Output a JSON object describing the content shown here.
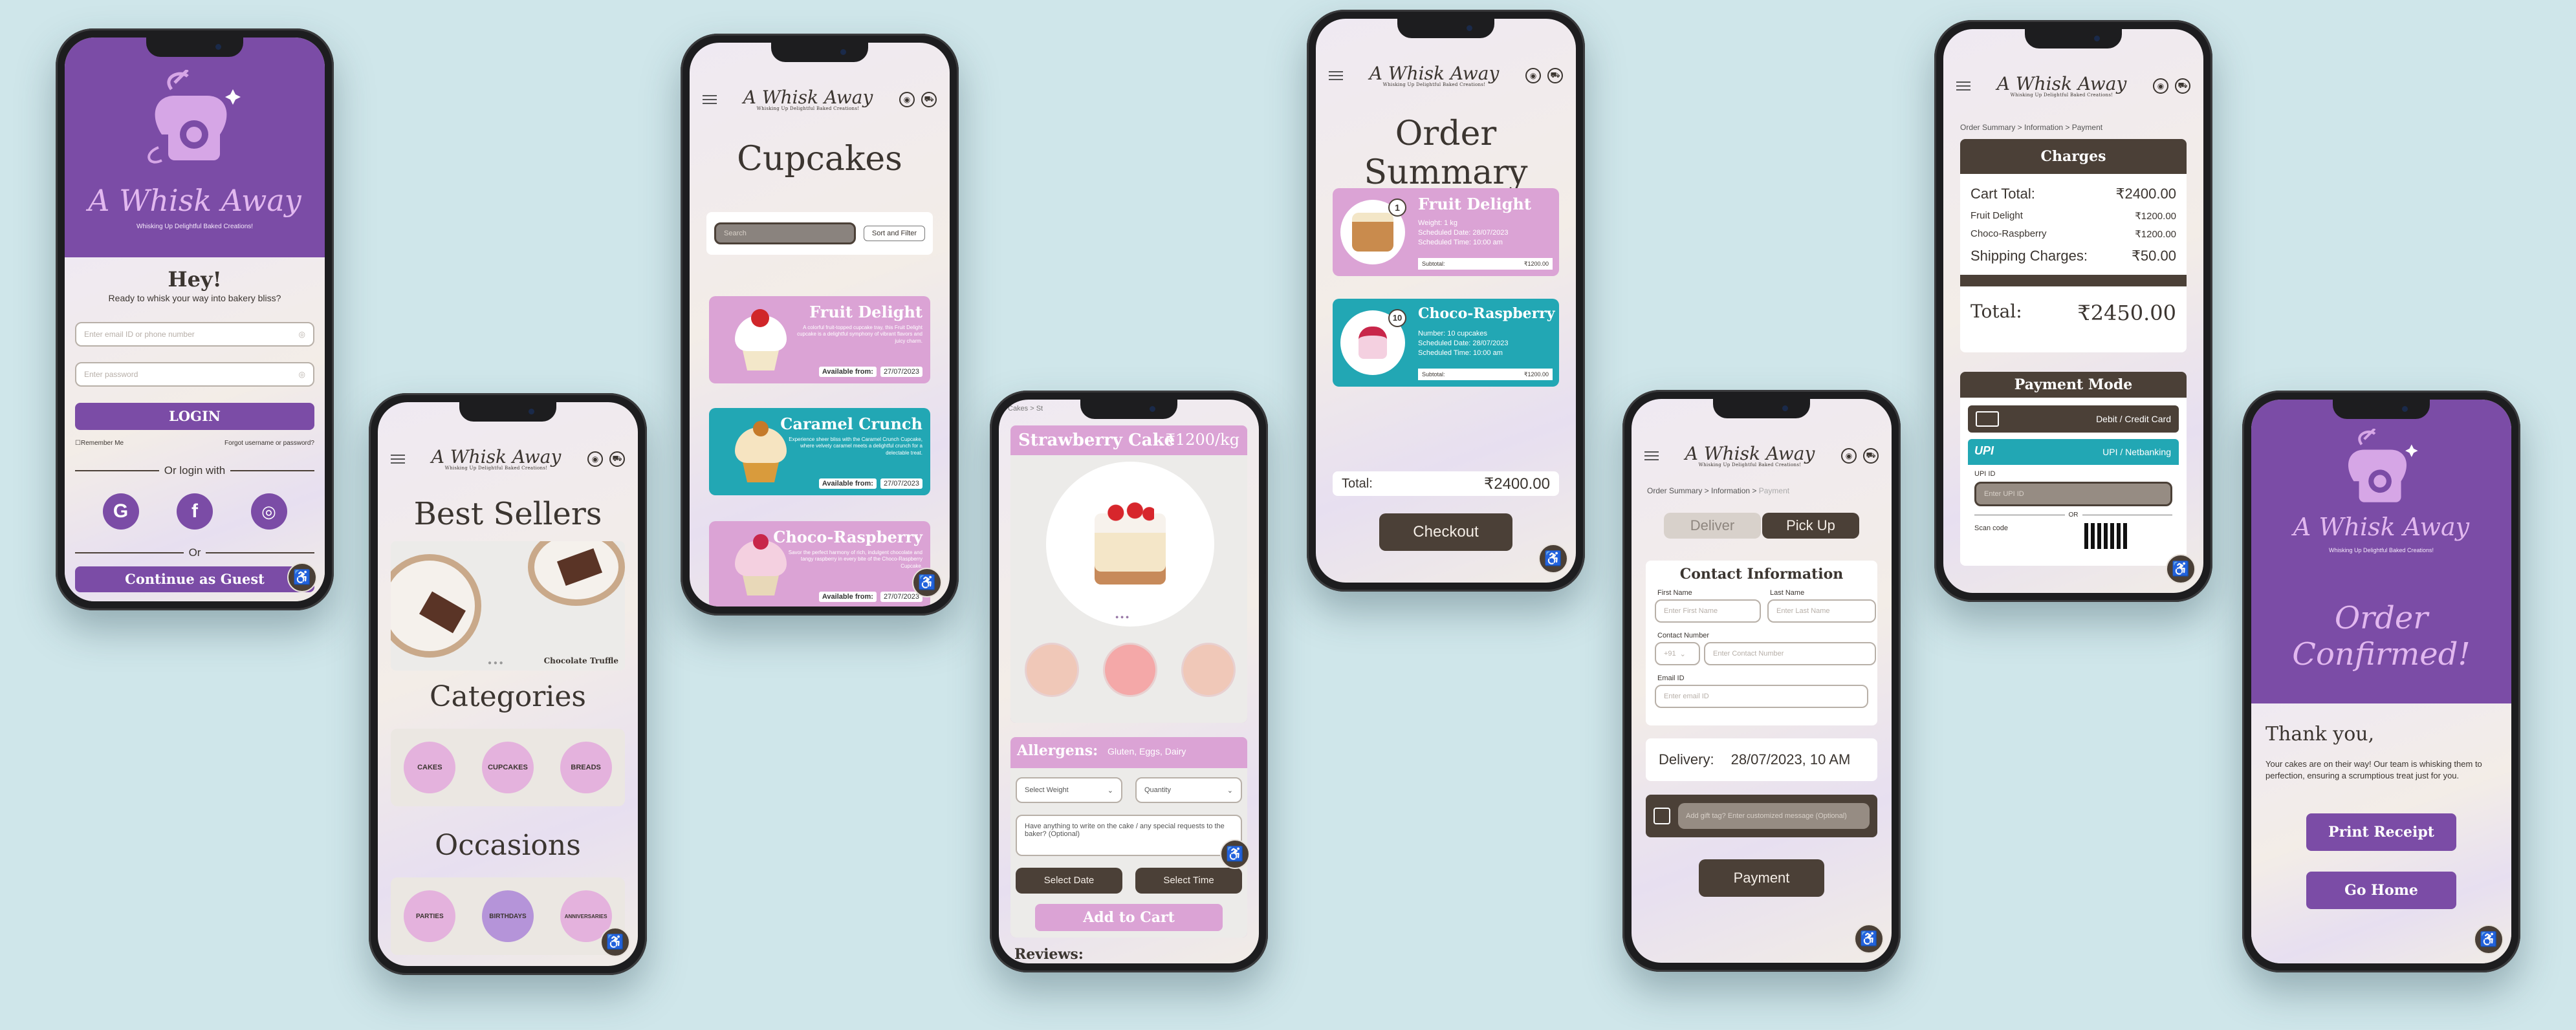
{
  "brand": {
    "name": "A Whisk Away",
    "tagline": "Whisking Up Delightful Baked Creations!"
  },
  "icons": {
    "accessibility": "accessibility-icon",
    "menu": "hamburger-menu-icon",
    "profile": "profile-icon",
    "cart": "cart-icon"
  },
  "colors": {
    "purple": "#7b4ca6",
    "dark": "#4b4037",
    "pink": "#dba3d5",
    "teal": "#22a7b4",
    "bg": "#cfe6ea"
  },
  "login": {
    "greeting": "Hey!",
    "subtitle": "Ready to whisk your way into bakery bliss?",
    "email_placeholder": "Enter email ID or phone number",
    "password_placeholder": "Enter password",
    "login_button": "LOGIN",
    "remember_me": "Remember Me",
    "forgot": "Forgot username or password?",
    "or_login_with": "Or login with",
    "or": "Or",
    "guest_button": "Continue as Guest"
  },
  "home": {
    "best_sellers": "Best Sellers",
    "featured_caption": "Chocolate Truffle",
    "categories_title": "Categories",
    "categories": [
      "CAKES",
      "CUPCAKES",
      "BREADS"
    ],
    "occasions_title": "Occasions",
    "occasions": [
      "PARTIES",
      "BIRTHDAYS",
      "ANNIVERSARIES"
    ]
  },
  "cupcakes": {
    "title": "Cupcakes",
    "search_placeholder": "Search",
    "sort_button": "Sort and Filter",
    "available_label": "Available from:",
    "items": [
      {
        "name": "Fruit Delight",
        "desc": "A colorful fruit-topped cupcake tray, this Fruit Delight cupcake is a delightful symphony of vibrant flavors and juicy charm.",
        "date": "27/07/2023"
      },
      {
        "name": "Caramel Crunch",
        "desc": "Experience sheer bliss with the Caramel Crunch Cupcake, where velvety caramel meets a delightful crunch for a delectable treat.",
        "date": "27/07/2023"
      },
      {
        "name": "Choco-Raspberry",
        "desc": "Savor the perfect harmony of rich, indulgent chocolate and tangy raspberry in every bite of the Choco-Raspberry Cupcake.",
        "date": "27/07/2023"
      }
    ]
  },
  "product": {
    "breadcrumb": "Cakes > St",
    "name": "Strawberry Cake",
    "price": "₹1200/kg",
    "allergens_label": "Allergens:",
    "allergens": "Gluten, Eggs, Dairy",
    "weight": "Select Weight",
    "quantity": "Quantity",
    "message_placeholder": "Have anything to write on the cake / any special requests to the baker? (Optional)",
    "select_date": "Select Date",
    "select_time": "Select Time",
    "add_to_cart": "Add to Cart",
    "reviews": "Reviews:"
  },
  "summary": {
    "title": "Order Summary",
    "items": [
      {
        "name": "Fruit Delight",
        "qty": "1",
        "lines": [
          "Weight: 1 kg",
          "Scheduled Date: 28/07/2023",
          "Scheduled Time: 10:00 am"
        ],
        "subtotal_label": "Subtotal:",
        "subtotal": "₹1200.00"
      },
      {
        "name": "Choco-Raspberry",
        "qty": "10",
        "lines": [
          "Number: 10 cupcakes",
          "Scheduled Date: 28/07/2023",
          "Scheduled Time: 10:00 am"
        ],
        "subtotal_label": "Subtotal:",
        "subtotal": "₹1200.00"
      }
    ],
    "total_label": "Total:",
    "total": "₹2400.00",
    "checkout": "Checkout"
  },
  "info": {
    "breadcrumb": "Order Summary > Information > ",
    "breadcrumb_current": "Payment",
    "deliver": "Deliver",
    "pickup": "Pick Up",
    "contact_title": "Contact Information",
    "first_name": "First Name",
    "first_name_ph": "Enter First Name",
    "last_name": "Last Name",
    "last_name_ph": "Enter Last Name",
    "contact_number": "Contact Number",
    "code": "+91",
    "contact_ph": "Enter Contact Number",
    "email": "Email ID",
    "email_ph": "Enter email ID",
    "delivery_label": "Delivery:",
    "delivery_value": "28/07/2023, 10 AM",
    "gift_ph": "Add gift tag? Enter customized message (Optional)",
    "payment_button": "Payment"
  },
  "payment": {
    "breadcrumb": "Order Summary > Information > Payment",
    "charges_title": "Charges",
    "rows": [
      {
        "label": "Cart Total:",
        "value": "₹2400.00"
      },
      {
        "label": "Fruit Delight",
        "value": "₹1200.00"
      },
      {
        "label": "Choco-Raspberry",
        "value": "₹1200.00"
      },
      {
        "label": "Shipping Charges:",
        "value": "₹50.00"
      }
    ],
    "total_label": "Total:",
    "total": "₹2450.00",
    "mode_title": "Payment Mode",
    "card": "Debit / Credit Card",
    "upi_logo": "UPI",
    "upi": "UPI / Netbanking",
    "upi_id": "UPI ID",
    "upi_ph": "Enter UPI ID",
    "or": "OR",
    "scan": "Scan code"
  },
  "confirmed": {
    "title": "Order Confirmed!",
    "thanks": "Thank you,",
    "message": "Your cakes are on their way! Our team is whisking them to perfection, ensuring a scrumptious treat just for you.",
    "print": "Print Receipt",
    "home": "Go Home"
  }
}
